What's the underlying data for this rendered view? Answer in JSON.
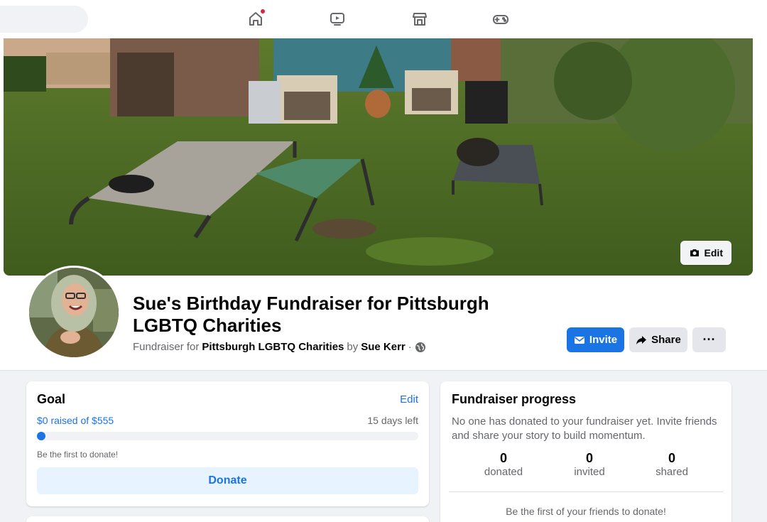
{
  "nav": {
    "icons": [
      "home-icon",
      "watch-icon",
      "marketplace-icon",
      "gaming-icon"
    ],
    "home_has_notification": true
  },
  "cover": {
    "edit_label": "Edit"
  },
  "fundraiser": {
    "title": "Sue's Birthday Fundraiser for Pittsburgh LGBTQ Charities",
    "subtitle_prefix": "Fundraiser for",
    "beneficiary": "Pittsburgh LGBTQ Charities",
    "by_text": "by",
    "organizer": "Sue Kerr",
    "separator": "·",
    "privacy_icon": "globe-icon"
  },
  "actions": {
    "invite_label": "Invite",
    "share_label": "Share",
    "more_label": "···"
  },
  "goal": {
    "title": "Goal",
    "edit_label": "Edit",
    "raised_text": "$0 raised of $555",
    "days_left": "15 days left",
    "progress_fraction": 0,
    "first_to_donate": "Be the first to donate!",
    "donate_label": "Donate"
  },
  "progress": {
    "title": "Fundraiser progress",
    "description": "No one has donated to your fundraiser yet. Invite friends and share your story to build momentum.",
    "stats": [
      {
        "value": "0",
        "label": "donated"
      },
      {
        "value": "0",
        "label": "invited"
      },
      {
        "value": "0",
        "label": "shared"
      }
    ],
    "friends_prompt": "Be the first of your friends to donate!"
  },
  "colors": {
    "accent": "#1b74e4",
    "notification": "#e41e3f",
    "secondary_text": "#65676b"
  }
}
